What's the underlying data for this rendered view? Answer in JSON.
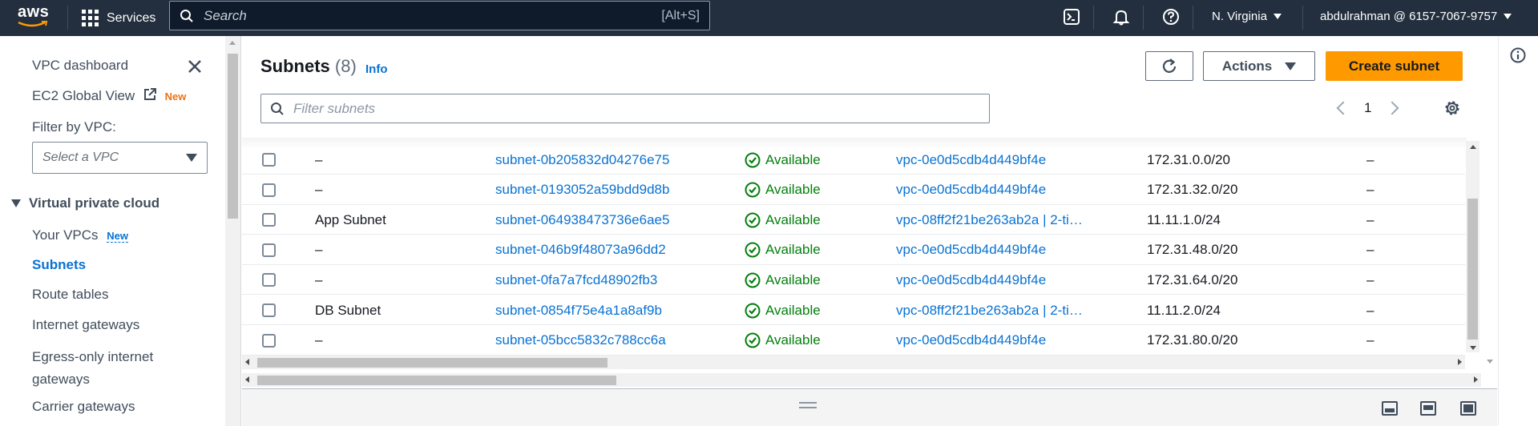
{
  "topnav": {
    "logo_text": "aws",
    "services_label": "Services",
    "search_placeholder": "Search",
    "search_shortcut": "[Alt+S]",
    "region": "N. Virginia",
    "account": "abdulrahman @ 6157-7067-9757"
  },
  "sidebar": {
    "dashboard": "VPC dashboard",
    "global_view": "EC2 Global View",
    "new_badge": "New",
    "filter_label": "Filter by VPC:",
    "select_placeholder": "Select a VPC",
    "section": "Virtual private cloud",
    "items": [
      {
        "label": "Your VPCs",
        "badge": "New"
      },
      {
        "label": "Subnets"
      },
      {
        "label": "Route tables"
      },
      {
        "label": "Internet gateways"
      },
      {
        "label": "Egress-only internet gateways"
      },
      {
        "label": "Carrier gateways"
      }
    ]
  },
  "main": {
    "title": "Subnets",
    "count": "(8)",
    "info": "Info",
    "actions_label": "Actions",
    "create_label": "Create subnet",
    "filter_placeholder": "Filter subnets",
    "page": "1"
  },
  "table": {
    "rows": [
      {
        "name": "–",
        "id": "subnet-0b205832d04276e75",
        "state": "Available",
        "vpc": "vpc-0e0d5cdb4d449bf4e",
        "cidr": "172.31.0.0/20",
        "ipv6": "–"
      },
      {
        "name": "–",
        "id": "subnet-0193052a59bdd9d8b",
        "state": "Available",
        "vpc": "vpc-0e0d5cdb4d449bf4e",
        "cidr": "172.31.32.0/20",
        "ipv6": "–"
      },
      {
        "name": "App Subnet",
        "id": "subnet-064938473736e6ae5",
        "state": "Available",
        "vpc": "vpc-08ff2f21be263ab2a | 2-ti…",
        "cidr": "11.11.1.0/24",
        "ipv6": "–"
      },
      {
        "name": "–",
        "id": "subnet-046b9f48073a96dd2",
        "state": "Available",
        "vpc": "vpc-0e0d5cdb4d449bf4e",
        "cidr": "172.31.48.0/20",
        "ipv6": "–"
      },
      {
        "name": "–",
        "id": "subnet-0fa7a7fcd48902fb3",
        "state": "Available",
        "vpc": "vpc-0e0d5cdb4d449bf4e",
        "cidr": "172.31.64.0/20",
        "ipv6": "–"
      },
      {
        "name": "DB Subnet",
        "id": "subnet-0854f75e4a1a8af9b",
        "state": "Available",
        "vpc": "vpc-08ff2f21be263ab2a | 2-ti…",
        "cidr": "11.11.2.0/24",
        "ipv6": "–"
      },
      {
        "name": "–",
        "id": "subnet-05bcc5832c788cc6a",
        "state": "Available",
        "vpc": "vpc-0e0d5cdb4d449bf4e",
        "cidr": "172.31.80.0/20",
        "ipv6": "–"
      }
    ]
  },
  "colors": {
    "nav_bg": "#232f3e",
    "link": "#0972d3",
    "primary": "#ff9900",
    "success": "#037f0c",
    "new_badge": "#ec7211"
  }
}
